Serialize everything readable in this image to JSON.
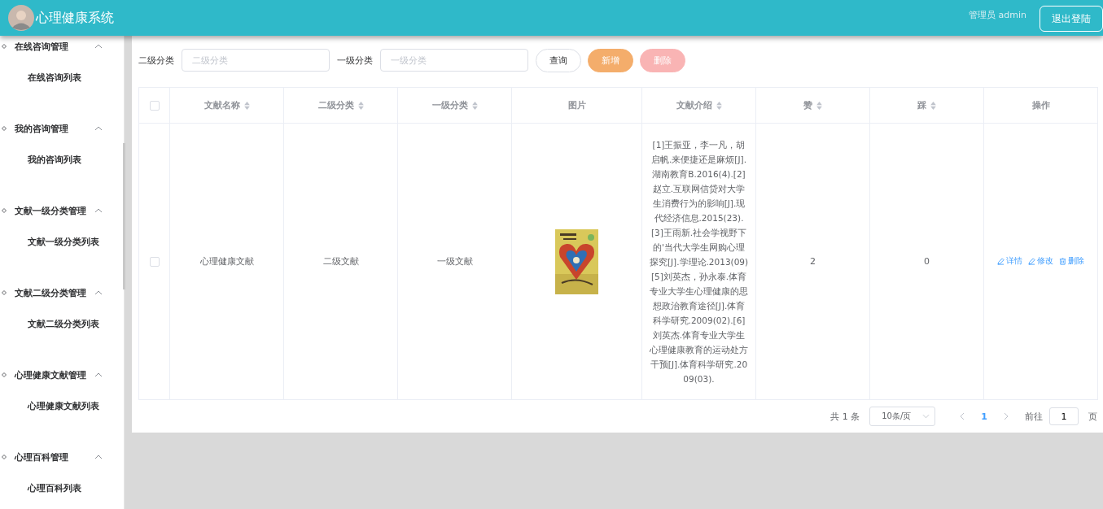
{
  "header": {
    "title": "心理健康系统",
    "user": "管理员 admin",
    "logout": "退出登陆"
  },
  "sidebar": [
    {
      "label": "在线咨询管理",
      "expanded": true,
      "children": [
        {
          "label": "在线咨询列表"
        }
      ]
    },
    {
      "label": "我的咨询管理",
      "expanded": true,
      "children": [
        {
          "label": "我的咨询列表"
        }
      ]
    },
    {
      "label": "文献一级分类管理",
      "expanded": true,
      "children": [
        {
          "label": "文献一级分类列表"
        }
      ]
    },
    {
      "label": "文献二级分类管理",
      "expanded": true,
      "children": [
        {
          "label": "文献二级分类列表"
        }
      ]
    },
    {
      "label": "心理健康文献管理",
      "expanded": true,
      "children": [
        {
          "label": "心理健康文献列表"
        }
      ]
    },
    {
      "label": "心理百科管理",
      "expanded": true,
      "children": [
        {
          "label": "心理百科列表"
        }
      ]
    }
  ],
  "filters": [
    {
      "label": "二级分类",
      "placeholder": "二级分类"
    },
    {
      "label": "一级分类",
      "placeholder": "一级分类"
    }
  ],
  "buttons": [
    {
      "label": "查询",
      "kind": "plain"
    },
    {
      "label": "新增",
      "kind": "warning"
    },
    {
      "label": "删除",
      "kind": "danger",
      "disabled": true
    }
  ],
  "table": {
    "columns": [
      {
        "label": "文献名称",
        "sortable": true
      },
      {
        "label": "二级分类",
        "sortable": true
      },
      {
        "label": "一级分类",
        "sortable": true
      },
      {
        "label": "图片",
        "sortable": false
      },
      {
        "label": "文献介绍",
        "sortable": true
      },
      {
        "label": "赞",
        "sortable": true
      },
      {
        "label": "踩",
        "sortable": true
      },
      {
        "label": "操作",
        "sortable": false
      }
    ],
    "rows": [
      {
        "checked": false,
        "cells": [
          "心理健康文献",
          "二级文献",
          "一级文献"
        ],
        "intro": "[1]王振亚，李一凡，胡启帆.来便捷还是麻烦[J].湖南教育B.2016(4).[2]赵立.互联网信贷对大学生消费行为的影响[J].现代经济信息.2015(23).[3]王雨新.社会学视野下的'当代大学生网购心理探究[J].学理论.2013(09)[5]刘英杰，孙永泰.体育专业大学生心理健康的思想政治教育途径[J].体育科学研究.2009(02).[6]刘英杰.体育专业大学生心理健康教育的运动处方干预[J].体育科学研究.2009(03).",
        "likes": "2",
        "dislikes": "0",
        "actions": [
          {
            "label": "详情",
            "kind": "edit"
          },
          {
            "label": "修改",
            "kind": "edit"
          },
          {
            "label": "删除",
            "kind": "delete"
          }
        ]
      }
    ],
    "header_checked": false
  },
  "pagination": {
    "total": "共 1 条",
    "page_size": "10条/页",
    "pages": [
      {
        "label": "1",
        "selected": true
      }
    ],
    "goto": "前往",
    "goto_value": "1",
    "page_suffix": "页"
  }
}
